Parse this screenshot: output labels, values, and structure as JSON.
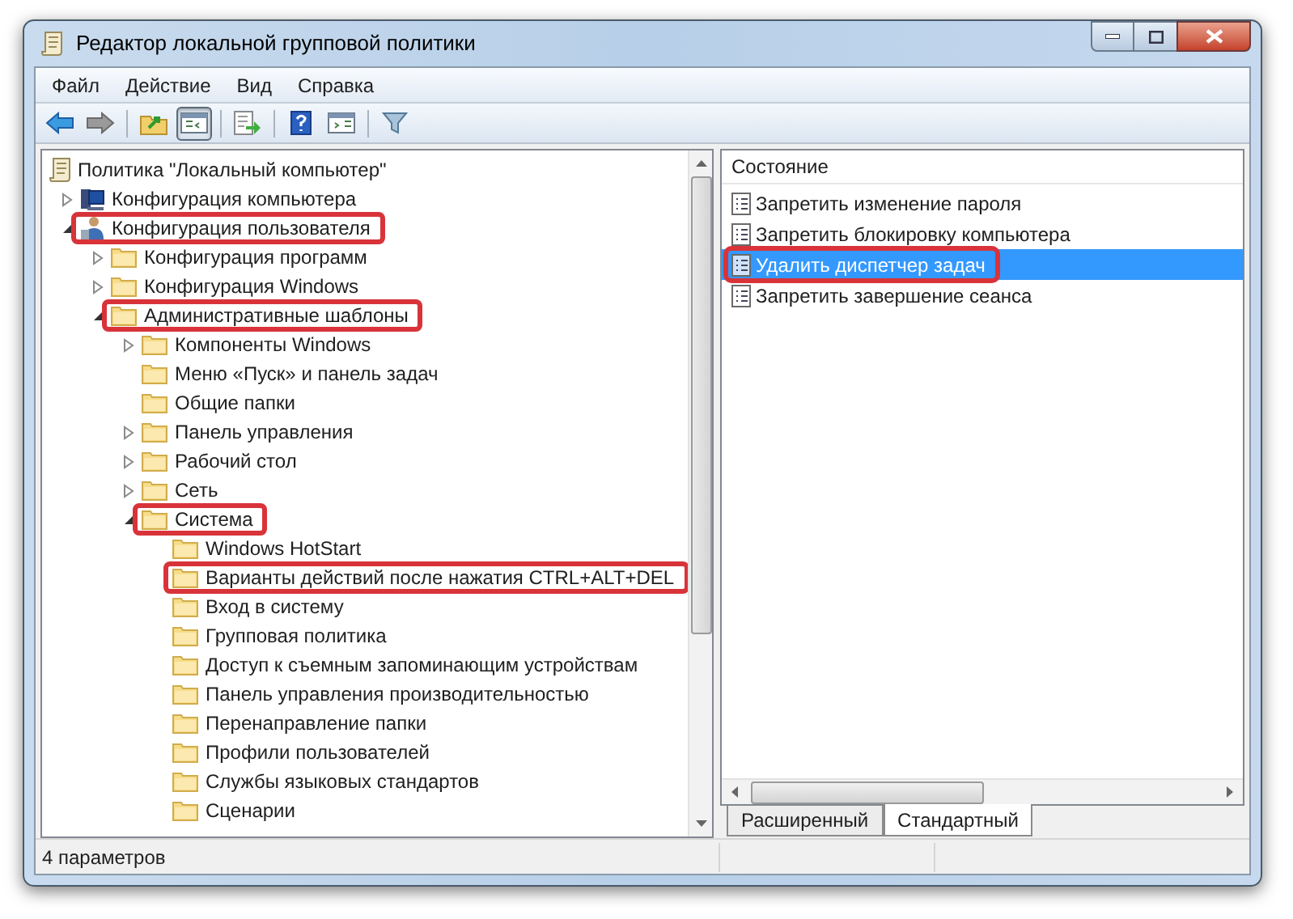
{
  "window": {
    "title": "Редактор локальной групповой политики"
  },
  "menu": [
    "Файл",
    "Действие",
    "Вид",
    "Справка"
  ],
  "toolbar": [
    {
      "kind": "back",
      "pressed": false
    },
    {
      "kind": "forward",
      "pressed": false
    },
    {
      "kind": "up",
      "pressed": false
    },
    {
      "kind": "tree",
      "pressed": true
    },
    {
      "kind": "export",
      "pressed": false
    },
    {
      "kind": "help",
      "pressed": false
    },
    {
      "kind": "panel",
      "pressed": false
    },
    {
      "kind": "filter",
      "pressed": false
    }
  ],
  "tree": [
    {
      "label": "Политика \"Локальный компьютер\"",
      "kind": "scroll",
      "highlighted": false,
      "children": [
        {
          "label": "Конфигурация компьютера",
          "kind": "computer",
          "expanded": false,
          "highlighted": false
        },
        {
          "label": "Конфигурация пользователя",
          "kind": "user",
          "expanded": true,
          "highlighted": true,
          "children": [
            {
              "label": "Конфигурация программ",
              "kind": "folder",
              "expanded": false,
              "highlighted": false
            },
            {
              "label": "Конфигурация Windows",
              "kind": "folder",
              "expanded": false,
              "highlighted": false
            },
            {
              "label": "Административные шаблоны",
              "kind": "folder",
              "expanded": true,
              "highlighted": true,
              "children": [
                {
                  "label": "Компоненты Windows",
                  "kind": "folder",
                  "expanded": false,
                  "highlighted": false
                },
                {
                  "label": "Меню «Пуск» и панель задач",
                  "kind": "folder",
                  "highlighted": false
                },
                {
                  "label": "Общие папки",
                  "kind": "folder",
                  "highlighted": false
                },
                {
                  "label": "Панель управления",
                  "kind": "folder",
                  "expanded": false,
                  "highlighted": false
                },
                {
                  "label": "Рабочий стол",
                  "kind": "folder",
                  "expanded": false,
                  "highlighted": false
                },
                {
                  "label": "Сеть",
                  "kind": "folder",
                  "expanded": false,
                  "highlighted": false
                },
                {
                  "label": "Система",
                  "kind": "folder",
                  "expanded": true,
                  "highlighted": true,
                  "children": [
                    {
                      "label": "Windows HotStart",
                      "kind": "folder",
                      "highlighted": false
                    },
                    {
                      "label": "Варианты действий после нажатия CTRL+ALT+DEL",
                      "kind": "folder",
                      "highlighted": true
                    },
                    {
                      "label": "Вход в систему",
                      "kind": "folder",
                      "highlighted": false
                    },
                    {
                      "label": "Групповая политика",
                      "kind": "folder",
                      "highlighted": false
                    },
                    {
                      "label": "Доступ к съемным запоминающим устройствам",
                      "kind": "folder",
                      "highlighted": false
                    },
                    {
                      "label": "Панель управления производительностью",
                      "kind": "folder",
                      "highlighted": false
                    },
                    {
                      "label": "Перенаправление папки",
                      "kind": "folder",
                      "highlighted": false
                    },
                    {
                      "label": "Профили пользователей",
                      "kind": "folder",
                      "highlighted": false
                    },
                    {
                      "label": "Службы языковых стандартов",
                      "kind": "folder",
                      "highlighted": false
                    },
                    {
                      "label": "Сценарии",
                      "kind": "folder",
                      "highlighted": false
                    }
                  ]
                }
              ]
            }
          ]
        }
      ]
    }
  ],
  "list": {
    "column": "Состояние",
    "items": [
      {
        "label": "Запретить изменение пароля",
        "selected": false,
        "highlighted": false
      },
      {
        "label": "Запретить блокировку компьютера",
        "selected": false,
        "highlighted": false
      },
      {
        "label": "Удалить диспетчер задач",
        "selected": true,
        "highlighted": true
      },
      {
        "label": "Запретить завершение сеанса",
        "selected": false,
        "highlighted": false
      }
    ]
  },
  "tabs": [
    {
      "label": "Расширенный",
      "selected": false
    },
    {
      "label": "Стандартный",
      "selected": true
    }
  ],
  "status_bar": "4 параметров"
}
